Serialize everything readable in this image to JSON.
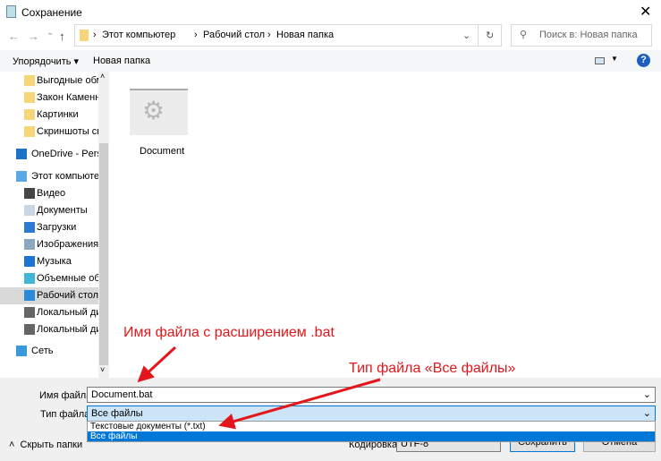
{
  "window": {
    "title": "Сохранение",
    "close": "✕"
  },
  "nav": {
    "back": "←",
    "forward": "→",
    "recent": "⌄",
    "up": "↑",
    "breadcrumb": [
      "Этот компьютер",
      "Рабочий стол",
      "Новая папка"
    ],
    "search_placeholder": "Поиск в: Новая папка"
  },
  "toolbar": {
    "organize": "Упорядочить ▾",
    "new_folder": "Новая папка",
    "help": "?"
  },
  "sidebar": {
    "items": [
      {
        "label": "Выгодные обме",
        "icon": "folder-icon"
      },
      {
        "label": "Закон Каменны",
        "icon": "folder-icon"
      },
      {
        "label": "Картинки",
        "icon": "folder-icon"
      },
      {
        "label": "Скриншоты сгу",
        "icon": "folder-icon"
      },
      {
        "label": "OneDrive - Persor",
        "icon": "cloud-icon"
      },
      {
        "label": "Этот компьютер",
        "icon": "computer-icon"
      },
      {
        "label": "Видео",
        "icon": "video-icon"
      },
      {
        "label": "Документы",
        "icon": "documents-icon"
      },
      {
        "label": "Загрузки",
        "icon": "download-icon"
      },
      {
        "label": "Изображения",
        "icon": "pictures-icon"
      },
      {
        "label": "Музыка",
        "icon": "music-icon"
      },
      {
        "label": "Объемные объ",
        "icon": "3d-objects-icon"
      },
      {
        "label": "Рабочий стол",
        "icon": "desktop-icon",
        "selected": true
      },
      {
        "label": "Локальный дис",
        "icon": "drive-icon"
      },
      {
        "label": "Локальный дис",
        "icon": "drive-icon"
      },
      {
        "label": "Сеть",
        "icon": "network-icon"
      }
    ]
  },
  "files": [
    {
      "name": "Document",
      "icon": "settings-file-icon"
    }
  ],
  "form": {
    "filename_label": "Имя файла:",
    "filename_value": "Document.bat",
    "filetype_label": "Тип файла:",
    "filetype_value": "Все файлы",
    "filetype_options": [
      "Текстовые документы (*.txt)",
      "Все файлы"
    ],
    "encoding_label": "Кодировка:",
    "encoding_value": "UTF-8",
    "save": "Сохранить",
    "cancel": "Отмена",
    "hide_folders": "Скрыть папки"
  },
  "annotations": {
    "note1": "Имя файла с расширением .bat",
    "note2": "Тип файла «Все файлы»",
    "color": "#e3161b"
  }
}
